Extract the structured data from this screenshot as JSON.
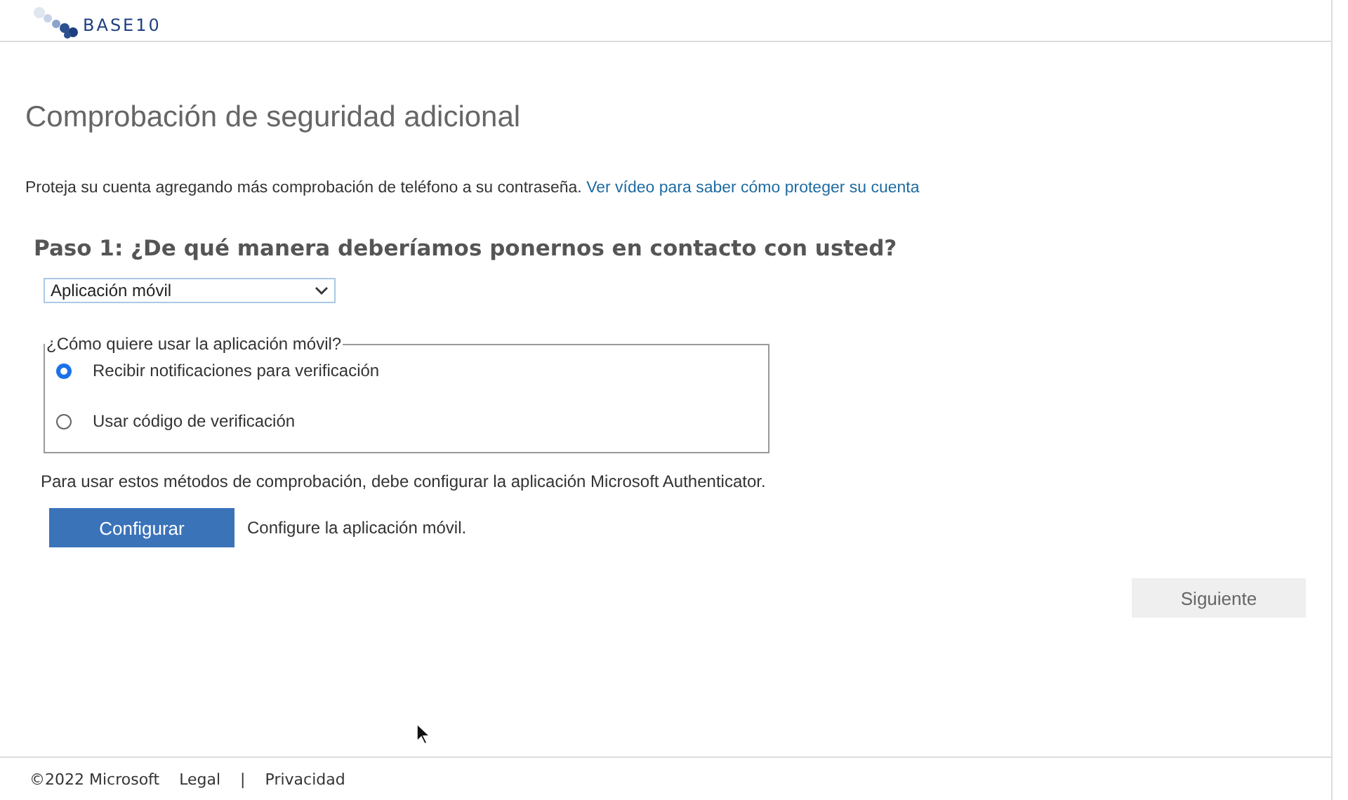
{
  "header": {
    "logo_text": "BASE10"
  },
  "title": "Comprobación de seguridad adicional",
  "intro": {
    "text": "Proteja su cuenta agregando más comprobación de teléfono a su contraseña.",
    "link": "Ver vídeo para saber cómo proteger su cuenta"
  },
  "step_heading": "Paso 1: ¿De qué manera deberíamos ponernos en contacto con usted?",
  "contact_method": {
    "value": "Aplicación móvil"
  },
  "usage_group": {
    "legend": "¿Cómo quiere usar la aplicación móvil?",
    "options": [
      {
        "label": "Recibir notificaciones para verificación",
        "selected": true
      },
      {
        "label": "Usar código de verificación",
        "selected": false
      }
    ]
  },
  "setup_note": "Para usar estos métodos de comprobación, debe configurar la aplicación Microsoft Authenticator.",
  "setup_button": "Configurar",
  "setup_hint": "Configure la aplicación móvil.",
  "next_button": "Siguiente",
  "footer": {
    "copyright": "©2022 Microsoft",
    "links": [
      "Legal",
      "Privacidad"
    ],
    "separator": "|"
  }
}
